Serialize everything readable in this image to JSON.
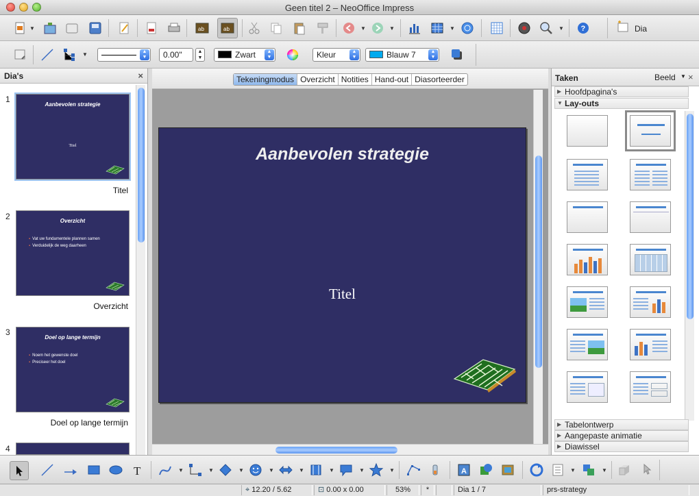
{
  "window": {
    "title": "Geen titel 2 – NeoOffice Impress"
  },
  "toolbar": {
    "slide_button_label": "Dia",
    "line_width_value": "0.00\"",
    "line_color_value": "Zwart",
    "area_style_value": "Kleur",
    "fill_color_value": "Blauw 7",
    "colors": {
      "line": "#000000",
      "fill": "#00aaee"
    }
  },
  "slides_panel": {
    "title": "Dia's",
    "close": "×",
    "slides": [
      {
        "number": "1",
        "title": "Aanbevolen strategie",
        "subtitle": "Titel",
        "label": "Titel"
      },
      {
        "number": "2",
        "title": "Overzicht",
        "bullets": [
          "Vat uw fundamentele plannen samen",
          "Verduidelijk de weg daarheen"
        ],
        "label": "Overzicht"
      },
      {
        "number": "3",
        "title": "Doel op lange termijn",
        "bullets": [
          "Noem het gewenste doel",
          "Preciseer het doel"
        ],
        "label": "Doel op lange termijn"
      },
      {
        "number": "4"
      }
    ]
  },
  "view_tabs": [
    "Tekeningmodus",
    "Overzicht",
    "Notities",
    "Hand-out",
    "Diasorteerder"
  ],
  "slide": {
    "title": "Aanbevolen strategie",
    "subtitle": "Titel",
    "background": "#2f2e64"
  },
  "tasks_panel": {
    "title": "Taken",
    "view_label": "Beeld",
    "close": "×",
    "sections": {
      "master_pages": "Hoofdpagina's",
      "layouts": "Lay-outs",
      "table_design": "Tabelontwerp",
      "custom_animation": "Aangepaste animatie",
      "slide_transition": "Diawissel"
    }
  },
  "statusbar": {
    "position": "12.20 / 5.62",
    "size": "0.00 x 0.00",
    "zoom": "53%",
    "modified": "*",
    "slide": "Dia 1 / 7",
    "master": "prs-strategy"
  }
}
